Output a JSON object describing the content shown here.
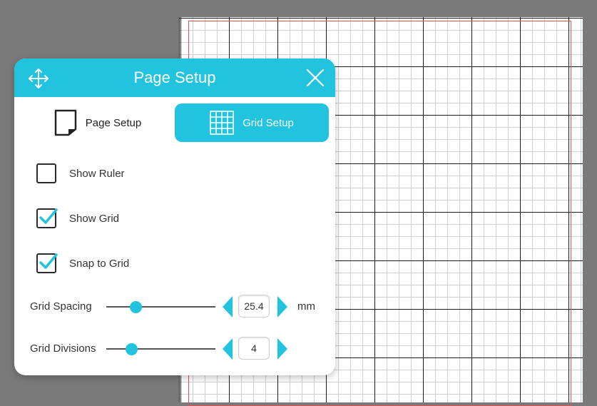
{
  "dialog": {
    "title": "Page Setup",
    "tabs": [
      {
        "label": "Page Setup",
        "icon": "page-icon",
        "active": false
      },
      {
        "label": "Grid Setup",
        "icon": "grid-icon",
        "active": true
      }
    ],
    "checkboxes": [
      {
        "label": "Show Ruler",
        "checked": false
      },
      {
        "label": "Show Grid",
        "checked": true
      },
      {
        "label": "Snap to Grid",
        "checked": true
      }
    ],
    "grid_spacing": {
      "label": "Grid Spacing",
      "value": "25.4",
      "unit": "mm"
    },
    "grid_divisions": {
      "label": "Grid Divisions",
      "value": "4"
    }
  },
  "colors": {
    "accent": "#22c3df",
    "margin_line": "#e05252",
    "background": "#7a7a7a"
  },
  "icons": [
    "move-icon",
    "close-icon",
    "page-icon",
    "grid-icon",
    "checkmark-icon",
    "arrow-left-icon",
    "arrow-right-icon"
  ]
}
